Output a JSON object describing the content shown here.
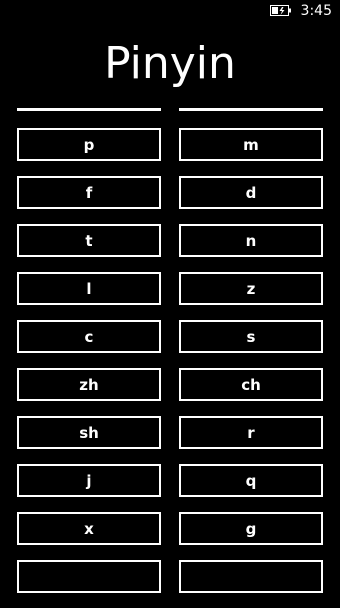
{
  "status_bar": {
    "time": "3:45",
    "battery_icon": "battery-charging-icon"
  },
  "title": "Pinyin",
  "columns": [
    {
      "keys": [
        "p",
        "f",
        "t",
        "l",
        "c",
        "zh",
        "sh",
        "j",
        "x",
        ""
      ]
    },
    {
      "keys": [
        "m",
        "d",
        "n",
        "z",
        "s",
        "ch",
        "r",
        "q",
        "g",
        ""
      ]
    }
  ],
  "colors": {
    "background": "#000000",
    "foreground": "#ffffff"
  }
}
